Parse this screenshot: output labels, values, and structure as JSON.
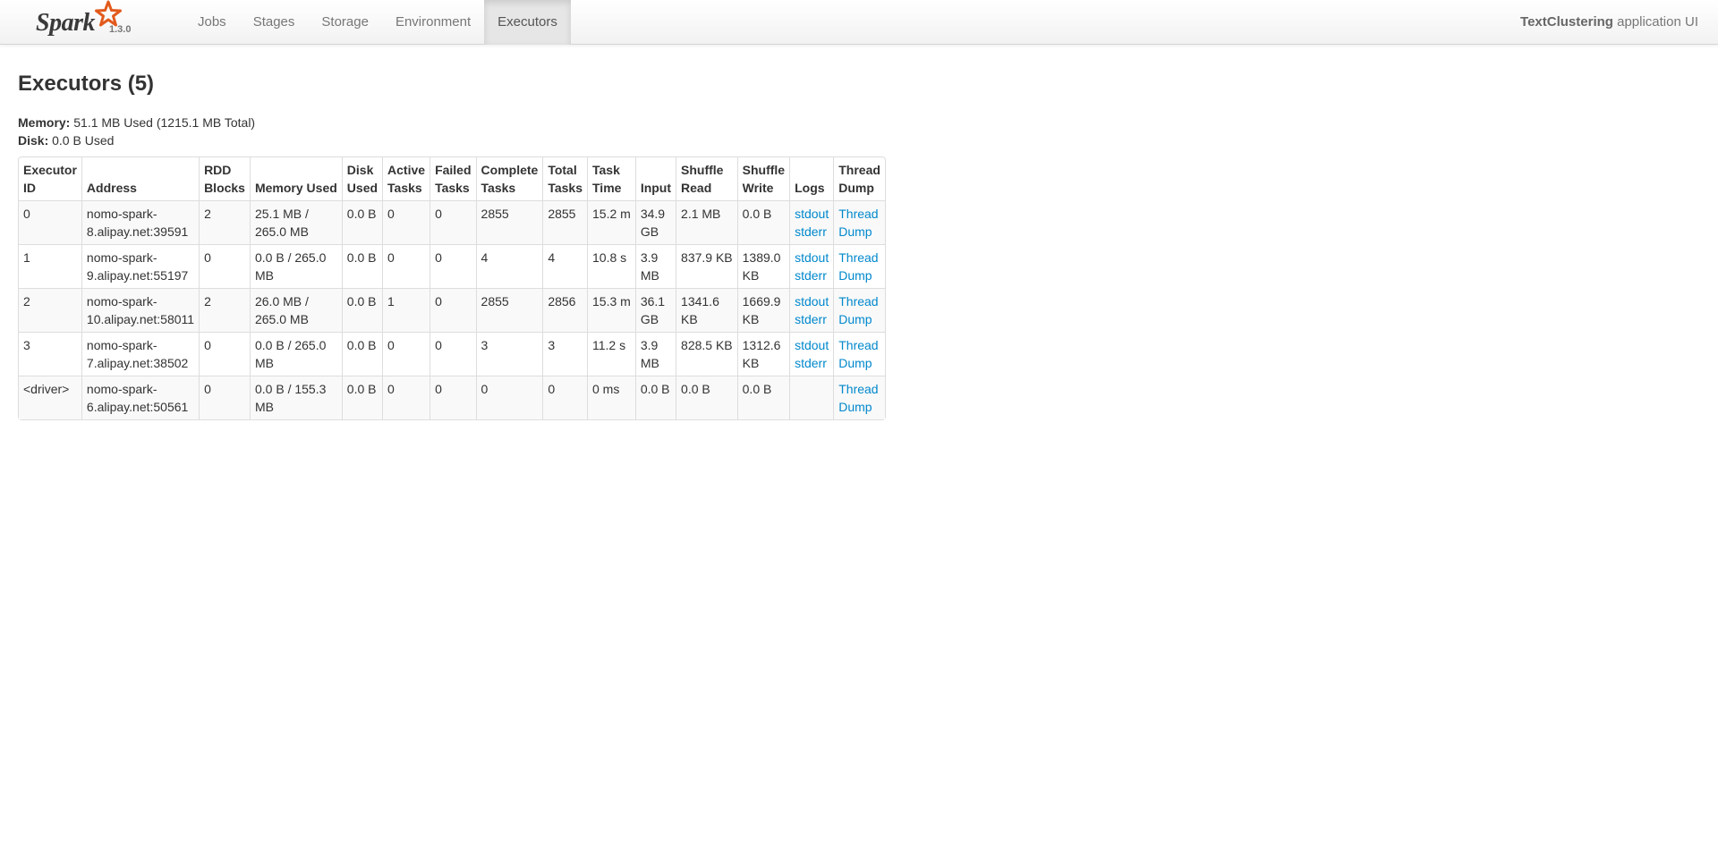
{
  "navbar": {
    "brand_word": "Spark",
    "version": "1.3.0",
    "tabs": [
      {
        "label": "Jobs",
        "active": false
      },
      {
        "label": "Stages",
        "active": false
      },
      {
        "label": "Storage",
        "active": false
      },
      {
        "label": "Environment",
        "active": false
      },
      {
        "label": "Executors",
        "active": true
      }
    ],
    "app_name": "TextClustering",
    "app_suffix": " application UI",
    "logo_star_color": "#e25a1c"
  },
  "page": {
    "title": "Executors (5)",
    "memory_label": "Memory:",
    "memory_value": " 51.1 MB Used (1215.1 MB Total)",
    "disk_label": "Disk:",
    "disk_value": " 0.0 B Used"
  },
  "table": {
    "headers": [
      [
        "Executor",
        "ID"
      ],
      [
        "Address"
      ],
      [
        "RDD",
        "Blocks"
      ],
      [
        "Memory Used"
      ],
      [
        "Disk",
        "Used"
      ],
      [
        "Active",
        "Tasks"
      ],
      [
        "Failed",
        "Tasks"
      ],
      [
        "Complete",
        "Tasks"
      ],
      [
        "Total",
        "Tasks"
      ],
      [
        "Task",
        "Time"
      ],
      [
        "Input"
      ],
      [
        "Shuffle",
        "Read"
      ],
      [
        "Shuffle",
        "Write"
      ],
      [
        "Logs"
      ],
      [
        "Thread",
        "Dump"
      ]
    ],
    "rows": [
      {
        "id": "0",
        "address": [
          "nomo-spark-",
          "8.alipay.net:39591"
        ],
        "rdd_blocks": "2",
        "memory_used": [
          "25.1 MB /",
          "265.0 MB"
        ],
        "disk_used": "0.0 B",
        "active_tasks": "0",
        "failed_tasks": "0",
        "complete_tasks": "2855",
        "total_tasks": "2855",
        "task_time": "15.2 m",
        "input": [
          "34.9",
          "GB"
        ],
        "shuffle_read": [
          "2.1 MB"
        ],
        "shuffle_write": [
          "0.0 B"
        ],
        "logs": [
          "stdout",
          "stderr"
        ],
        "thread_dump": [
          "Thread",
          "Dump"
        ]
      },
      {
        "id": "1",
        "address": [
          "nomo-spark-",
          "9.alipay.net:55197"
        ],
        "rdd_blocks": "0",
        "memory_used": [
          "0.0 B / 265.0",
          "MB"
        ],
        "disk_used": "0.0 B",
        "active_tasks": "0",
        "failed_tasks": "0",
        "complete_tasks": "4",
        "total_tasks": "4",
        "task_time": "10.8 s",
        "input": [
          "3.9",
          "MB"
        ],
        "shuffle_read": [
          "837.9 KB"
        ],
        "shuffle_write": [
          "1389.0",
          "KB"
        ],
        "logs": [
          "stdout",
          "stderr"
        ],
        "thread_dump": [
          "Thread",
          "Dump"
        ]
      },
      {
        "id": "2",
        "address": [
          "nomo-spark-",
          "10.alipay.net:58011"
        ],
        "rdd_blocks": "2",
        "memory_used": [
          "26.0 MB /",
          "265.0 MB"
        ],
        "disk_used": "0.0 B",
        "active_tasks": "1",
        "failed_tasks": "0",
        "complete_tasks": "2855",
        "total_tasks": "2856",
        "task_time": "15.3 m",
        "input": [
          "36.1",
          "GB"
        ],
        "shuffle_read": [
          "1341.6",
          "KB"
        ],
        "shuffle_write": [
          "1669.9",
          "KB"
        ],
        "logs": [
          "stdout",
          "stderr"
        ],
        "thread_dump": [
          "Thread",
          "Dump"
        ]
      },
      {
        "id": "3",
        "address": [
          "nomo-spark-",
          "7.alipay.net:38502"
        ],
        "rdd_blocks": "0",
        "memory_used": [
          "0.0 B / 265.0",
          "MB"
        ],
        "disk_used": "0.0 B",
        "active_tasks": "0",
        "failed_tasks": "0",
        "complete_tasks": "3",
        "total_tasks": "3",
        "task_time": "11.2 s",
        "input": [
          "3.9",
          "MB"
        ],
        "shuffle_read": [
          "828.5 KB"
        ],
        "shuffle_write": [
          "1312.6",
          "KB"
        ],
        "logs": [
          "stdout",
          "stderr"
        ],
        "thread_dump": [
          "Thread",
          "Dump"
        ]
      },
      {
        "id": "<driver>",
        "address": [
          "nomo-spark-",
          "6.alipay.net:50561"
        ],
        "rdd_blocks": "0",
        "memory_used": [
          "0.0 B / 155.3",
          "MB"
        ],
        "disk_used": "0.0 B",
        "active_tasks": "0",
        "failed_tasks": "0",
        "complete_tasks": "0",
        "total_tasks": "0",
        "task_time": "0 ms",
        "input": [
          "0.0 B"
        ],
        "shuffle_read": [
          "0.0 B"
        ],
        "shuffle_write": [
          "0.0 B"
        ],
        "logs": [],
        "thread_dump": [
          "Thread",
          "Dump"
        ]
      }
    ]
  }
}
